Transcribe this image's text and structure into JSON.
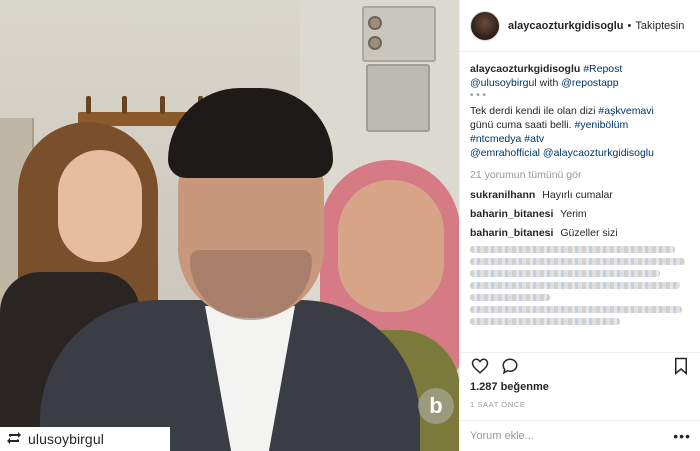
{
  "header": {
    "username": "alaycaozturkgidisoglu",
    "separator": "•",
    "follow_status": "Takiptesin"
  },
  "caption": {
    "username": "alaycaozturkgidisoglu",
    "repost_tag": "#Repost",
    "repost_user": "@ulusoybirgul",
    "with_text": "with",
    "app_user": "@repostapp",
    "dots": "• • •",
    "text_1": "Tek derdi kendi ile olan dizi",
    "tag_1": "#aşkvemavi",
    "text_2": "günü cuma saati belli.",
    "tag_2": "#yenibölüm",
    "tag_3": "#ntcmedya",
    "tag_4": "#atv",
    "mention_1": "@emrahofficial",
    "mention_2": "@alaycaozturkgidisoglu"
  },
  "view_all_comments": "21 yorumun tümünü gör",
  "comments": [
    {
      "user": "sukranilhann",
      "text": "Hayırlı cumalar"
    },
    {
      "user": "baharin_bitanesi",
      "text": "Yerim"
    },
    {
      "user": "baharin_bitanesi",
      "text": "Güzeller sizi"
    }
  ],
  "likes": "1.287 beğenme",
  "time": "1 SAAT ÖNCE",
  "comment_input": {
    "placeholder": "Yorum ekle..."
  },
  "more_label": "•••",
  "repost_banner": {
    "user": "ulusoybirgul"
  },
  "watermark": "b",
  "icons": [
    "heart-icon",
    "comment-icon",
    "bookmark-icon",
    "repost-icon"
  ]
}
